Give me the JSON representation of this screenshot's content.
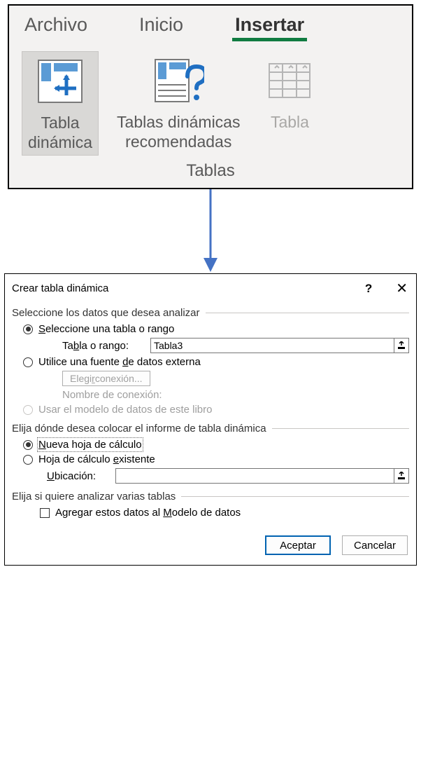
{
  "ribbon": {
    "tabs": {
      "file": "Archivo",
      "home": "Inicio",
      "insert": "Insertar"
    },
    "buttons": {
      "pivot": "Tabla\ndinámica",
      "recommended": "Tablas dinámicas\nrecomendadas",
      "table": "Tabla"
    },
    "group_label": "Tablas"
  },
  "dialog": {
    "title": "Crear tabla dinámica",
    "section_select": "Seleccione los datos que desea analizar",
    "opt_select_range": "Seleccione una tabla o rango",
    "label_range": "Tabla o rango:",
    "range_value": "Tabla3",
    "opt_external": "Utilice una fuente de datos externa",
    "btn_choose_conn": "Elegir conexión...",
    "label_conn_name": "Nombre de conexión:",
    "opt_data_model": "Usar el modelo de datos de este libro",
    "section_place": "Elija dónde desea colocar el informe de tabla dinámica",
    "opt_new_sheet": "Nueva hoja de cálculo",
    "opt_existing_sheet": "Hoja de cálculo existente",
    "label_location": "Ubicación:",
    "location_value": "",
    "section_multi": "Elija si quiere analizar varias tablas",
    "chk_add_model": "Agregar estos datos al Modelo de datos",
    "btn_ok": "Aceptar",
    "btn_cancel": "Cancelar"
  }
}
